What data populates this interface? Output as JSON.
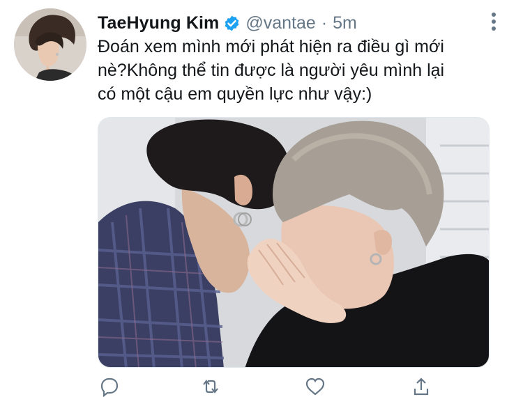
{
  "tweet": {
    "author": {
      "display_name": "TaeHyung Kim",
      "verified": true,
      "handle": "@vantae",
      "separator": "·",
      "time": "5m"
    },
    "text": "Đoán xem mình mới phát hiện ra điều gì mới\nnè?Không thể tin được là người yêu mình lại\ncó một cậu em quyền lực như vậy:)",
    "media": {
      "type": "photo"
    },
    "actions": [
      "reply-icon",
      "retweet-icon",
      "like-icon",
      "share-icon"
    ]
  },
  "colors": {
    "text": "#14171a",
    "secondary": "#657786",
    "verified_blue": "#1da1f2",
    "background": "#ffffff"
  }
}
